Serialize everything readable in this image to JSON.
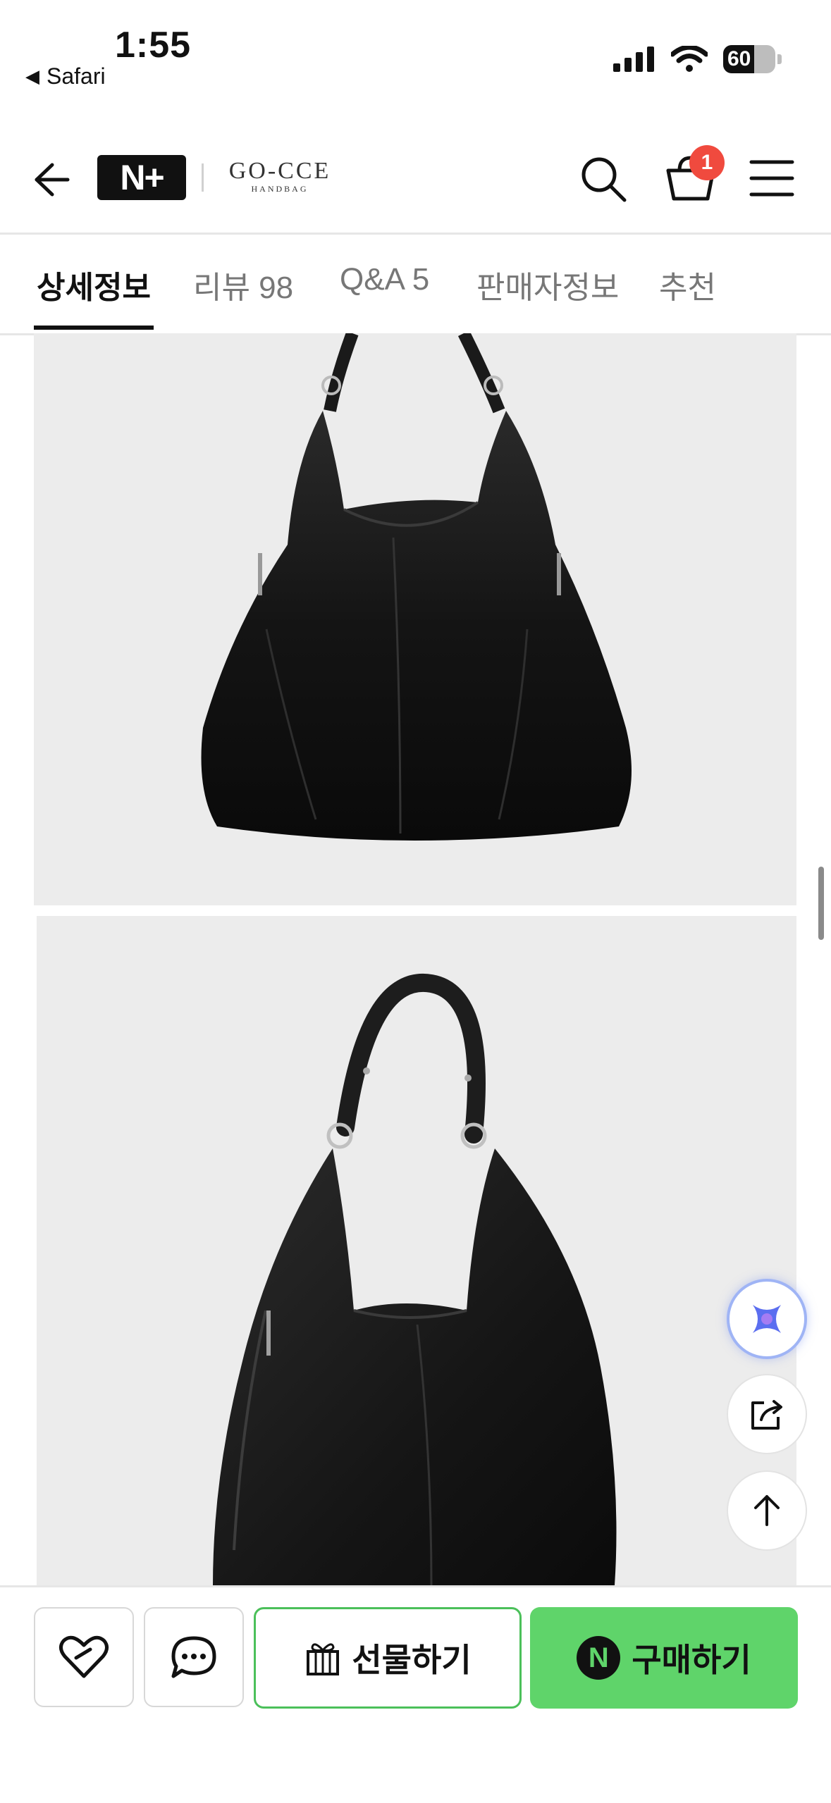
{
  "status": {
    "time": "1:55",
    "back_app": "Safari",
    "battery": "60"
  },
  "header": {
    "logo": "N+",
    "brand": {
      "name": "GO-CCE",
      "sub": "HANDBAG"
    },
    "cart_count": "1"
  },
  "tabs": [
    {
      "label": "상세정보",
      "active": true
    },
    {
      "label": "리뷰 98",
      "active": false
    },
    {
      "label": "Q&A 5",
      "active": false
    },
    {
      "label": "판매자정보",
      "active": false
    },
    {
      "label": "추천",
      "active": false
    }
  ],
  "actions": {
    "gift_label": "선물하기",
    "buy_label": "구매하기",
    "buy_badge": "N"
  },
  "colors": {
    "buy_green": "#5fd46a",
    "gift_border": "#4bc05a",
    "badge_red": "#f04a3e"
  },
  "icons": [
    "back-icon",
    "search-icon",
    "cart-icon",
    "menu-icon",
    "ai-assistant-icon",
    "share-icon",
    "arrow-up-icon",
    "heart-icon",
    "chat-icon",
    "gift-icon"
  ]
}
